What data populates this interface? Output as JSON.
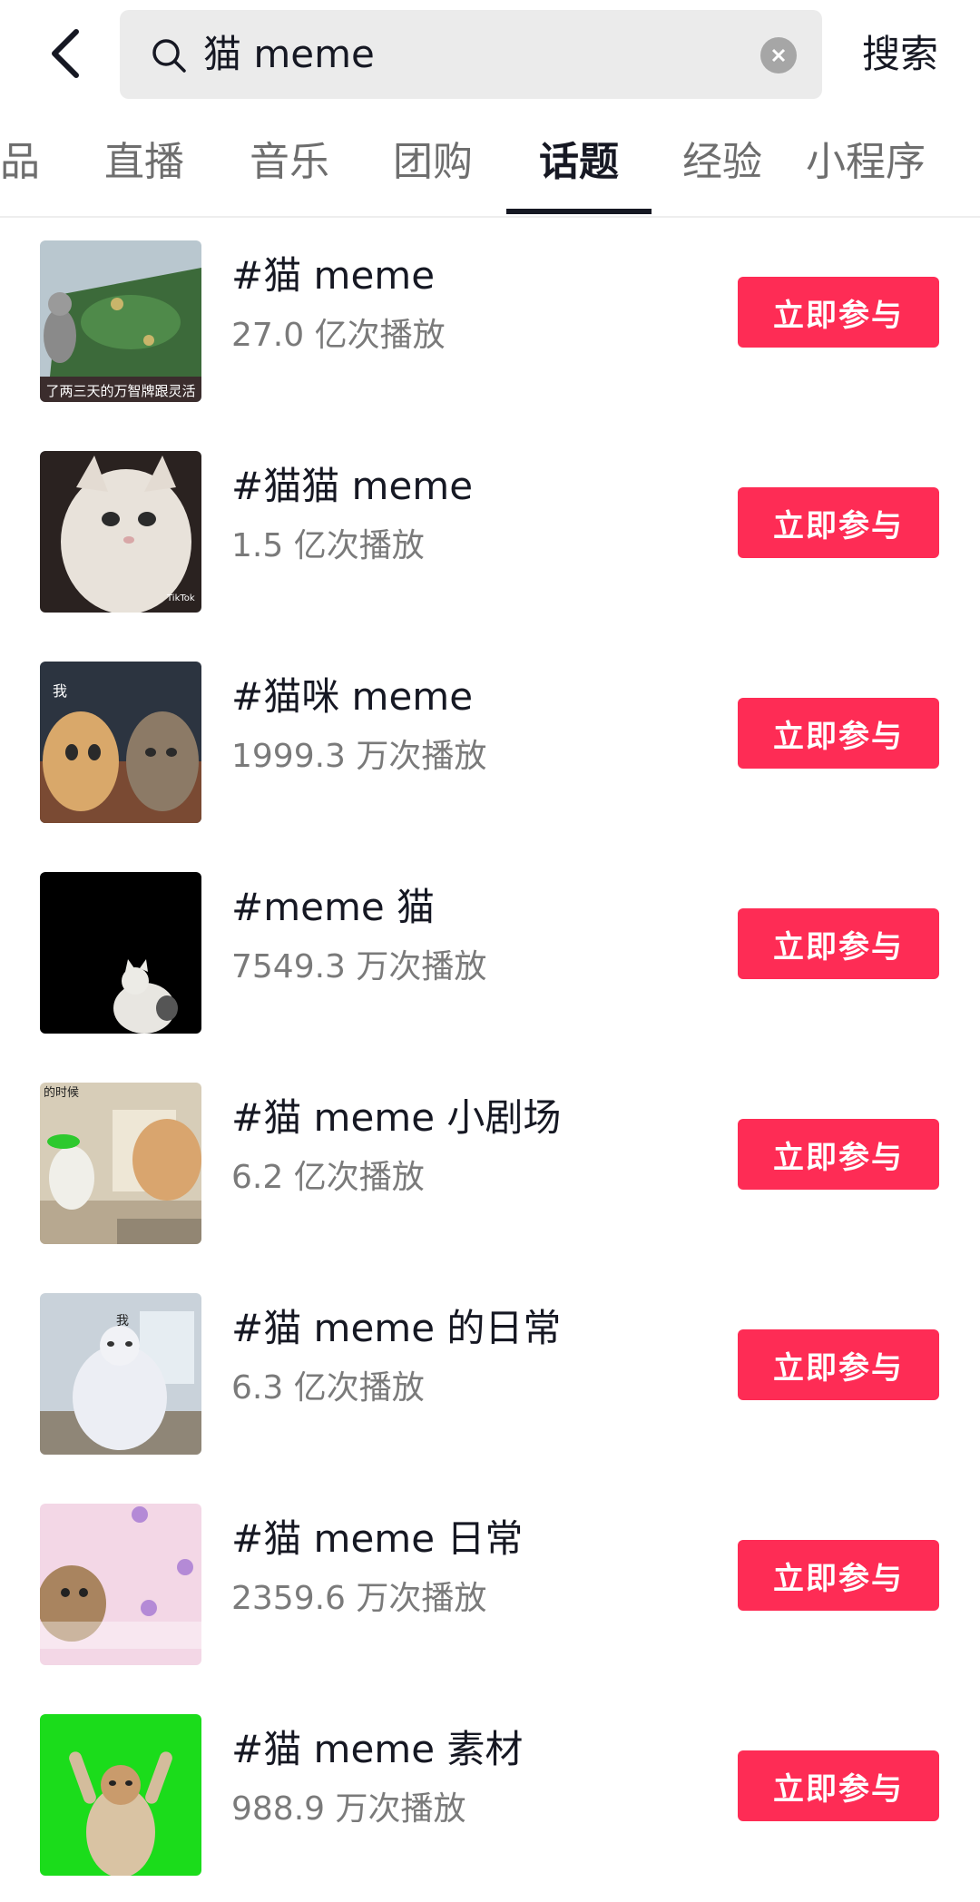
{
  "search": {
    "query": "猫 meme",
    "button_label": "搜索"
  },
  "tabs": [
    {
      "label": "品"
    },
    {
      "label": "直播"
    },
    {
      "label": "音乐"
    },
    {
      "label": "团购"
    },
    {
      "label": "话题",
      "active": true
    },
    {
      "label": "经验"
    },
    {
      "label": "小程序"
    }
  ],
  "topics": [
    {
      "title": "#猫 meme",
      "plays": "27.0 亿次播放",
      "join_label": "立即参与",
      "thumb_caption": "了两三天的万智牌跟灵活"
    },
    {
      "title": "#猫猫 meme",
      "plays": "1.5 亿次播放",
      "join_label": "立即参与",
      "thumb_caption": "TikTok"
    },
    {
      "title": "#猫咪 meme",
      "plays": "1999.3 万次播放",
      "join_label": "立即参与",
      "thumb_caption": "我"
    },
    {
      "title": "#meme 猫",
      "plays": "7549.3 万次播放",
      "join_label": "立即参与",
      "thumb_caption": ""
    },
    {
      "title": "#猫 meme 小剧场",
      "plays": "6.2 亿次播放",
      "join_label": "立即参与",
      "thumb_caption": "的时候"
    },
    {
      "title": "#猫 meme 的日常",
      "plays": "6.3 亿次播放",
      "join_label": "立即参与",
      "thumb_caption": "我"
    },
    {
      "title": "#猫 meme 日常",
      "plays": "2359.6 万次播放",
      "join_label": "立即参与",
      "thumb_caption": ""
    },
    {
      "title": "#猫 meme 素材",
      "plays": "988.9 万次播放",
      "join_label": "立即参与",
      "thumb_caption": ""
    }
  ],
  "colors": {
    "accent": "#fe2c55",
    "text": "#161823",
    "muted": "#7a7a7a",
    "search_bg": "#ebebeb"
  }
}
